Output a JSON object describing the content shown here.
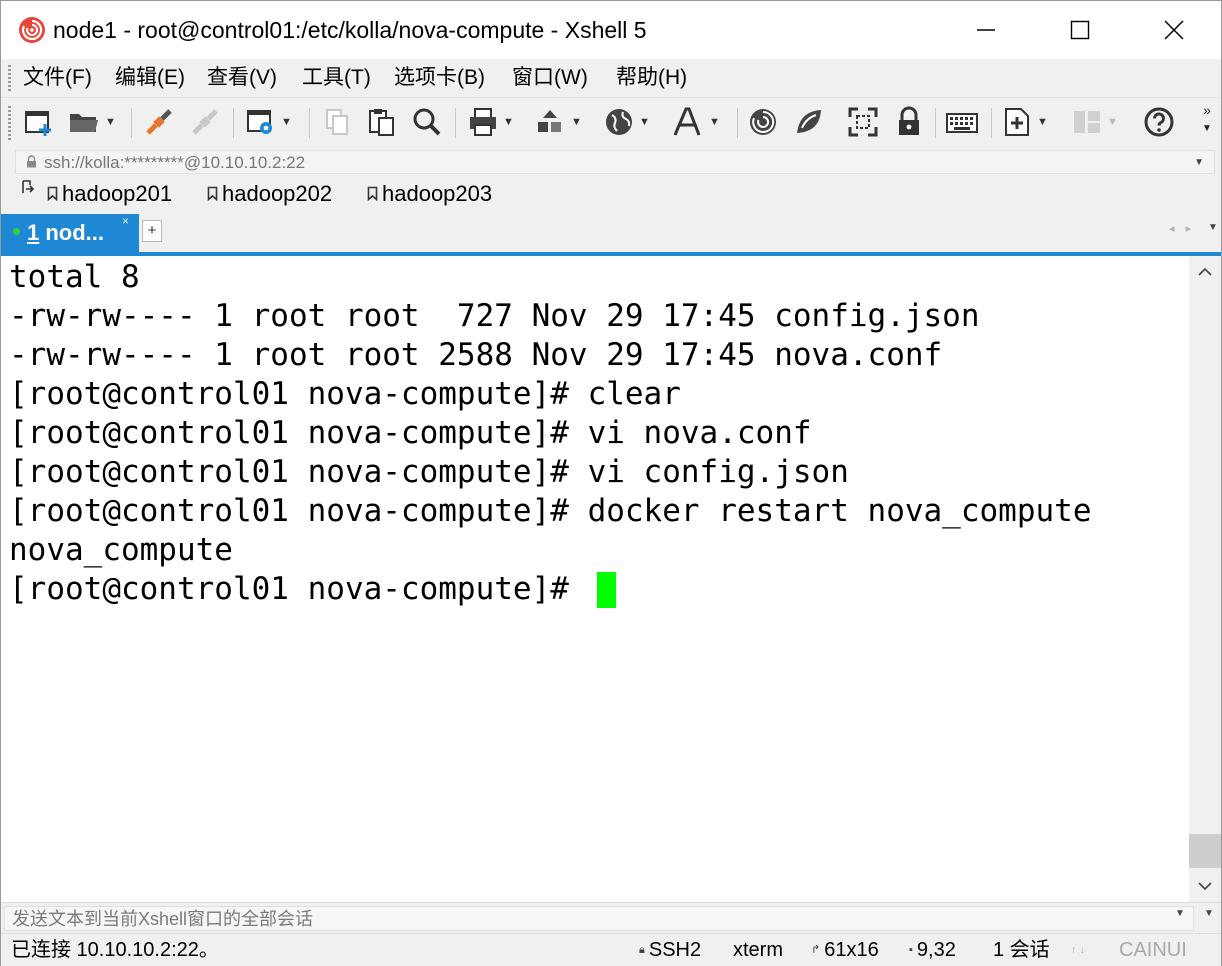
{
  "window": {
    "title": "node1 - root@control01:/etc/kolla/nova-compute - Xshell 5",
    "icon": "xshell-logo-icon"
  },
  "menu": {
    "items": [
      "文件(F)",
      "编辑(E)",
      "查看(V)",
      "工具(T)",
      "选项卡(B)",
      "窗口(W)",
      "帮助(H)"
    ]
  },
  "toolbar": {
    "buttons": [
      "new-session-icon",
      "open-folder-icon",
      "reconnect-icon",
      "disconnect-icon",
      "properties-icon",
      "copy-icon",
      "paste-icon",
      "find-icon",
      "print-icon",
      "transfer-icon",
      "globe-icon",
      "font-icon",
      "xftp-icon",
      "xmanager-icon",
      "fullscreen-icon",
      "lock-icon",
      "keyboard-icon",
      "compose-icon",
      "layout-icon",
      "help-icon"
    ],
    "overflow": "»"
  },
  "address": {
    "value": "ssh://kolla:*********@10.10.10.2:22"
  },
  "links": {
    "items": [
      "hadoop201",
      "hadoop202",
      "hadoop203"
    ]
  },
  "tabs": {
    "active_number": "1",
    "active_label": " nod...",
    "close": "×",
    "add": "+"
  },
  "terminal": {
    "lines": [
      "total 8",
      "-rw-rw---- 1 root root  727 Nov 29 17:45 config.json",
      "-rw-rw---- 1 root root 2588 Nov 29 17:45 nova.conf",
      "[root@control01 nova-compute]# clear",
      "[root@control01 nova-compute]# vi nova.conf",
      "[root@control01 nova-compute]# vi config.json",
      "[root@control01 nova-compute]# docker restart nova_compute",
      "nova_compute",
      "[root@control01 nova-compute]# "
    ],
    "cursor_color": "#00ff00"
  },
  "compose": {
    "placeholder": "发送文本到当前Xshell窗口的全部会话"
  },
  "status": {
    "connection": "已连接 10.10.10.2:22。",
    "protocol": "SSH2",
    "terminal_type": "xterm",
    "size": "61x16",
    "cursor_pos": "9,32",
    "sessions": "1 会话",
    "caps": "CAINUI"
  },
  "colors": {
    "accent": "#1e88d4",
    "cursor": "#00ff00",
    "chrome": "#f0f0f0"
  }
}
